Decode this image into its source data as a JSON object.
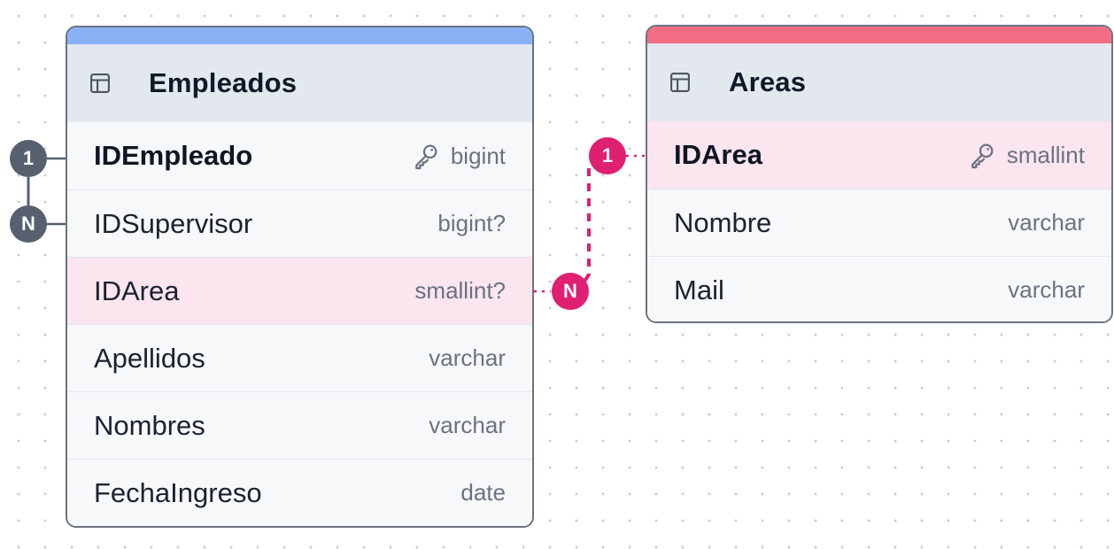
{
  "tables": {
    "empleados": {
      "title": "Empleados",
      "accent_color": "#8ab1f6",
      "icon": "table-icon",
      "columns": [
        {
          "name": "IDEmpleado",
          "type": "bigint",
          "primary_key": true
        },
        {
          "name": "IDSupervisor",
          "type": "bigint?"
        },
        {
          "name": "IDArea",
          "type": "smallint?",
          "highlighted": true
        },
        {
          "name": "Apellidos",
          "type": "varchar"
        },
        {
          "name": "Nombres",
          "type": "varchar"
        },
        {
          "name": "FechaIngreso",
          "type": "date"
        }
      ]
    },
    "areas": {
      "title": "Areas",
      "accent_color": "#f46c84",
      "icon": "table-icon",
      "columns": [
        {
          "name": "IDArea",
          "type": "smallint",
          "primary_key": true,
          "highlighted": true
        },
        {
          "name": "Nombre",
          "type": "varchar"
        },
        {
          "name": "Mail",
          "type": "varchar"
        }
      ]
    }
  },
  "relationships": [
    {
      "from": "Empleados.IDEmpleado",
      "to": "Empleados.IDSupervisor",
      "from_cardinality": "1",
      "to_cardinality": "N",
      "color": "#56606f"
    },
    {
      "from": "Areas.IDArea",
      "to": "Empleados.IDArea",
      "from_cardinality": "1",
      "to_cardinality": "N",
      "color": "#de1f72"
    }
  ],
  "colors": {
    "header_bg": "#e3e8ee",
    "highlight_row": "#fbe5ef",
    "border": "#6b7280"
  }
}
